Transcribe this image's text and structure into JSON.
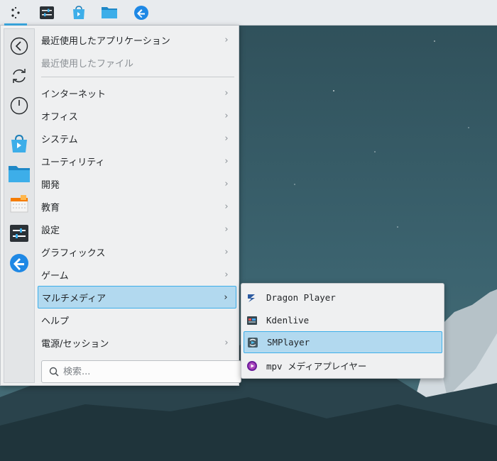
{
  "panel": {
    "items": [
      {
        "icon": "app-launcher-icon",
        "active": true
      },
      {
        "icon": "settings-sliders-icon"
      },
      {
        "icon": "software-store-icon"
      },
      {
        "icon": "file-manager-folder-icon"
      },
      {
        "icon": "browser-icon"
      }
    ]
  },
  "sidebar": {
    "items": [
      {
        "icon": "back-arrow-icon"
      },
      {
        "icon": "refresh-icon"
      },
      {
        "icon": "power-icon"
      },
      {
        "icon": "software-store-icon"
      },
      {
        "icon": "folder-icon"
      },
      {
        "icon": "package-installer-icon"
      },
      {
        "icon": "settings-sliders-icon"
      },
      {
        "icon": "browser-icon"
      }
    ]
  },
  "menu": {
    "categories": [
      {
        "label": "最近使用したアプリケーション",
        "has_submenu": true
      },
      {
        "label": "最近使用したファイル",
        "has_submenu": false,
        "disabled": true
      },
      {
        "label": "インターネット",
        "has_submenu": true
      },
      {
        "label": "オフィス",
        "has_submenu": true
      },
      {
        "label": "システム",
        "has_submenu": true
      },
      {
        "label": "ユーティリティ",
        "has_submenu": true
      },
      {
        "label": "開発",
        "has_submenu": true
      },
      {
        "label": "教育",
        "has_submenu": true
      },
      {
        "label": "設定",
        "has_submenu": true
      },
      {
        "label": "グラフィックス",
        "has_submenu": true
      },
      {
        "label": "ゲーム",
        "has_submenu": true
      },
      {
        "label": "マルチメディア",
        "has_submenu": true,
        "selected": true
      },
      {
        "label": "ヘルプ",
        "has_submenu": false
      },
      {
        "label": "電源/セッション",
        "has_submenu": true
      }
    ],
    "arrow_glyph": "›",
    "search": {
      "placeholder": "検索..."
    }
  },
  "submenu": {
    "items": [
      {
        "label": "Dragon Player",
        "icon": "dragon-player-icon"
      },
      {
        "label": "Kdenlive",
        "icon": "kdenlive-icon"
      },
      {
        "label": "SMPlayer",
        "icon": "smplayer-icon",
        "selected": true
      },
      {
        "label": "mpv メディアプレイヤー",
        "icon": "mpv-icon"
      }
    ]
  },
  "colors": {
    "accent": "#3daee9",
    "selection": "#b2d9ef",
    "menu_bg": "#eff0f1",
    "panel_bg": "#e8ebee"
  }
}
